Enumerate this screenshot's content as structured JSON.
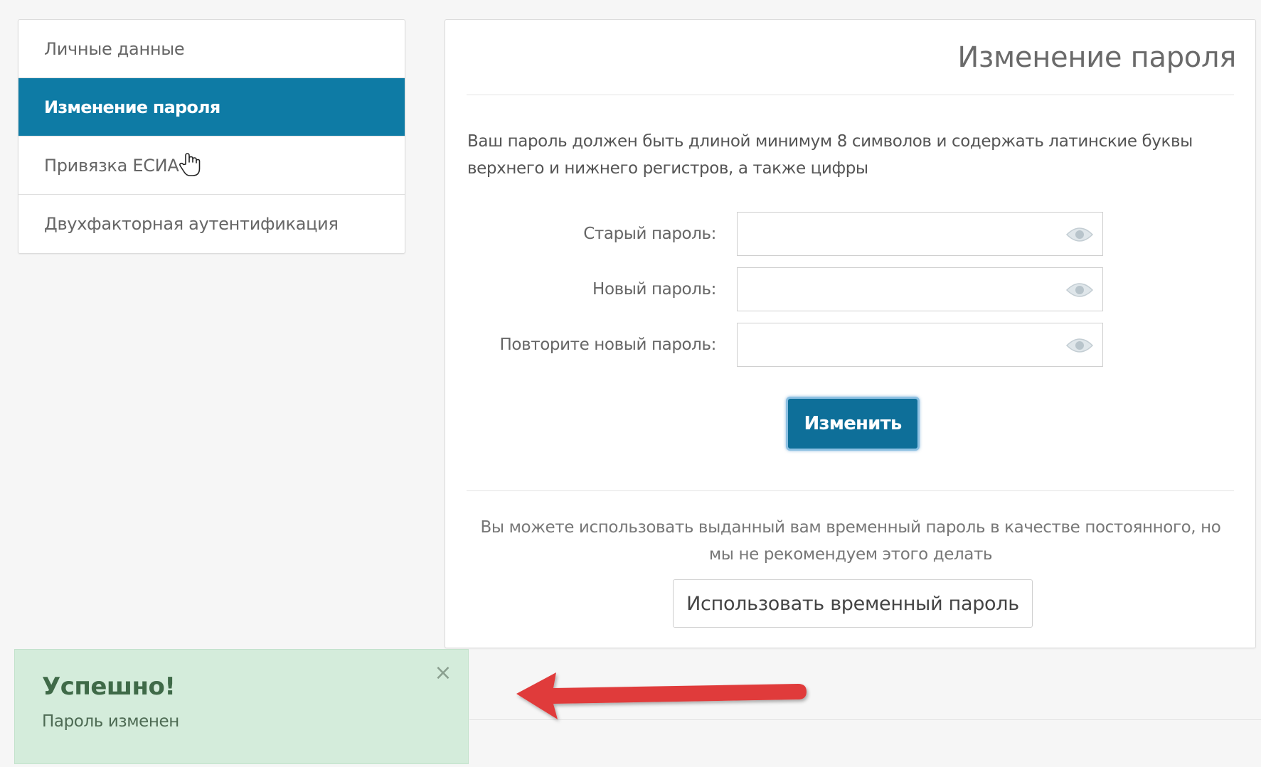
{
  "sidebar": {
    "items": [
      {
        "label": "Личные данные",
        "active": false
      },
      {
        "label": "Изменение пароля",
        "active": true
      },
      {
        "label": "Привязка ЕСИА",
        "active": false
      },
      {
        "label": "Двухфакторная аутентификация",
        "active": false
      }
    ]
  },
  "panel": {
    "title": "Изменение пароля",
    "hint": "Ваш пароль должен быть длиной минимум 8 символов и содержать латинские буквы верхнего и нижнего регистров, а также цифры",
    "fields": {
      "old": {
        "label": "Старый пароль:",
        "value": ""
      },
      "new": {
        "label": "Новый пароль:",
        "value": ""
      },
      "repeat": {
        "label": "Повторите новый пароль:",
        "value": ""
      }
    },
    "submit_label": "Изменить",
    "temp_note": "Вы можете использовать выданный вам временный пароль в качестве постоянного, но мы не рекомендуем этого делать",
    "temp_button_label": "Использовать временный пароль"
  },
  "toast": {
    "title": "Успешно!",
    "message": "Пароль изменен",
    "close_symbol": "×"
  },
  "colors": {
    "accent": "#0e7ba5",
    "button": "#0e6f99",
    "success_bg": "#d4ecdb",
    "annotation_arrow": "#e03a3a"
  },
  "icons": {
    "field_toggle": "eye-icon",
    "pointer": "hand-pointer-icon",
    "annotation": "red-arrow-icon"
  }
}
